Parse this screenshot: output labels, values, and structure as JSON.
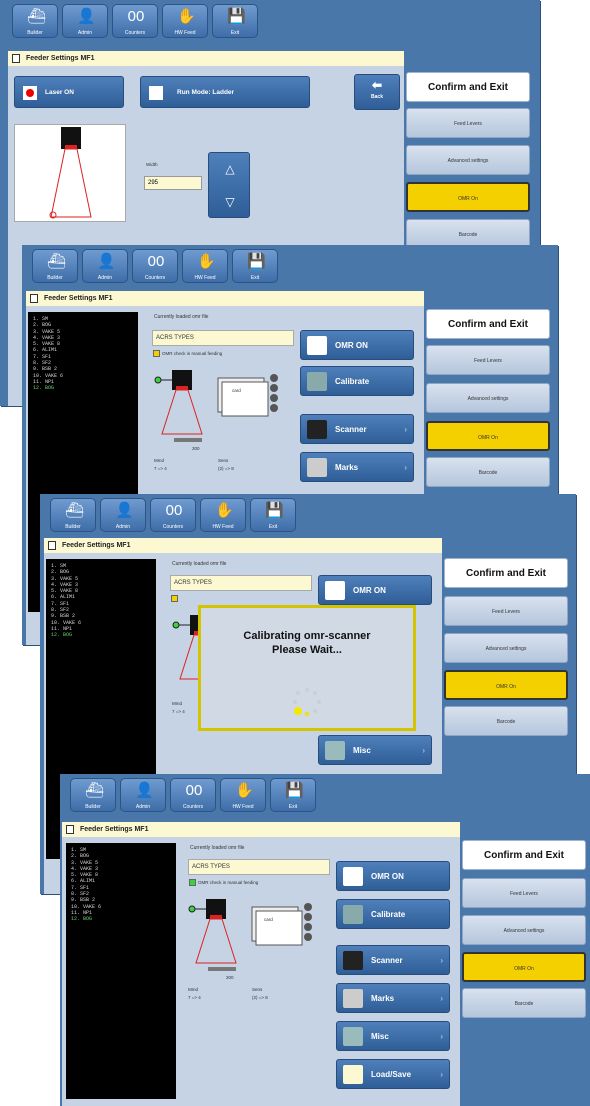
{
  "toolbar": {
    "buttons": [
      {
        "label": "Builder",
        "icon": "builder-icon"
      },
      {
        "label": "Admin",
        "icon": "admin-icon"
      },
      {
        "label": "Counters",
        "icon": "counters-icon"
      },
      {
        "label": "HW Feed",
        "icon": "hand-feed-icon"
      },
      {
        "label": "Exit",
        "icon": "save-icon"
      }
    ]
  },
  "window_title": "Feeder Settings MF1",
  "right_panel": {
    "confirm": "Confirm and Exit",
    "feed_levers": "Feed Levers",
    "advanced": "Advanced settings",
    "omr": "OMR On",
    "barcode": "Barcode"
  },
  "screen1": {
    "laser": "Laser ON",
    "run_mode": "Run Mode: Ladder",
    "back": "Back",
    "width_label": "Width",
    "width_value": "295"
  },
  "omr_screen": {
    "loaded_label": "Currently loaded omr file",
    "loaded_value": "ACRS TYPES",
    "check_label": "OMR check in manual feeding",
    "sensor_readout_left_label": "Mmd",
    "sensor_readout_left_value": "7 => 4",
    "sensor_readout_right_label": "Sens",
    "sensor_readout_right_value": "(2) => 8",
    "scale_value": "300",
    "card_text": "card",
    "list": [
      "1. SM",
      "2. BOG",
      "3. VAKE 5",
      "4. VAKE 3",
      "5. VAKE 8",
      "6. ALIM1",
      "7. SF1",
      "8. SF2",
      "9. BSB 2",
      "10. VAKE 6",
      "11. NP1",
      "12. BOG"
    ],
    "side_buttons": [
      "OMR ON",
      "Calibrate",
      "Scanner",
      "Marks",
      "Misc",
      "Load/Save"
    ]
  },
  "dialog": {
    "line1": "Calibrating omr-scanner",
    "line2": "Please Wait..."
  },
  "colors": {
    "background": "#4a77aa",
    "title": "#fbf8d2",
    "omr_yellow": "#f5d000"
  }
}
